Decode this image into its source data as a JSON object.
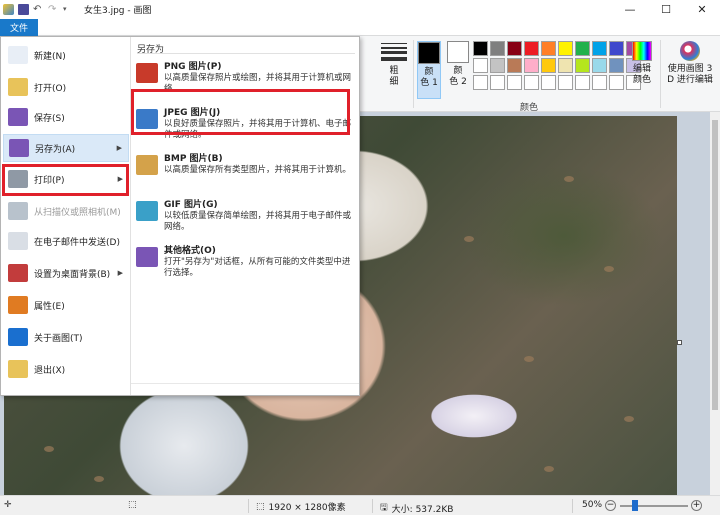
{
  "window": {
    "title": "女生3.jpg - 画图",
    "minimize_glyph": "—",
    "maximize_glyph": "☐",
    "close_glyph": "✕"
  },
  "ribbon": {
    "file_tab": "文件",
    "size_label": "粗\n细",
    "color1_label": "颜\n色 1",
    "color2_label": "颜\n色 2",
    "colors_group_label": "颜色",
    "edit_colors_label": "编辑\n颜色",
    "paint3d_label": "使用画图 3\nD 进行编辑",
    "color1": "#000000",
    "color2": "#ffffff",
    "palette": [
      "#000000",
      "#7f7f7f",
      "#880015",
      "#ed1c24",
      "#ff7f27",
      "#fff200",
      "#22b14c",
      "#00a2e8",
      "#3f48cc",
      "#a349a4",
      "#ffffff",
      "#c3c3c3",
      "#b97a57",
      "#ffaec9",
      "#ffc90e",
      "#efe4b0",
      "#b5e61d",
      "#99d9ea",
      "#7092be",
      "#c8bfe7",
      "#ffffff",
      "#ffffff",
      "#ffffff",
      "#ffffff",
      "#ffffff",
      "#ffffff",
      "#ffffff",
      "#ffffff",
      "#ffffff",
      "#ffffff"
    ]
  },
  "file_menu": {
    "items": [
      {
        "label": "新建(N)",
        "icon": "new-file-icon",
        "color": "#e8eef6",
        "has_arrow": false,
        "disabled": false
      },
      {
        "label": "打开(O)",
        "icon": "open-folder-icon",
        "color": "#e8c35a",
        "has_arrow": false,
        "disabled": false
      },
      {
        "label": "保存(S)",
        "icon": "save-disk-icon",
        "color": "#7a55b5",
        "has_arrow": false,
        "disabled": false
      },
      {
        "label": "另存为(A)",
        "icon": "save-as-icon",
        "color": "#7a55b5",
        "has_arrow": true,
        "disabled": false
      },
      {
        "label": "打印(P)",
        "icon": "printer-icon",
        "color": "#8f99a5",
        "has_arrow": true,
        "disabled": false
      },
      {
        "label": "从扫描仪或照相机(M)",
        "icon": "scanner-icon",
        "color": "#b8c2cc",
        "has_arrow": false,
        "disabled": true
      },
      {
        "label": "在电子邮件中发送(D)",
        "icon": "email-icon",
        "color": "#d9dee5",
        "has_arrow": false,
        "disabled": false
      },
      {
        "label": "设置为桌面背景(B)",
        "icon": "desktop-background-icon",
        "color": "#c23c3c",
        "has_arrow": true,
        "disabled": false
      },
      {
        "label": "属性(E)",
        "icon": "checkmark-icon",
        "color": "#e07b22",
        "has_arrow": false,
        "disabled": false
      },
      {
        "label": "关于画图(T)",
        "icon": "info-icon",
        "color": "#1a6fcf",
        "has_arrow": false,
        "disabled": false
      },
      {
        "label": "退出(X)",
        "icon": "exit-icon",
        "color": "#e8c35a",
        "has_arrow": false,
        "disabled": false
      }
    ],
    "save_as_heading": "另存为",
    "save_as_options": [
      {
        "title": "PNG 图片(P)",
        "desc": "以高质量保存照片或绘图，并将其用于计算机或网络。",
        "icon": "png-image-icon",
        "color": "#c83a2a"
      },
      {
        "title": "JPEG 图片(J)",
        "desc": "以良好质量保存照片，并将其用于计算机、电子邮件或网络。",
        "icon": "jpeg-image-icon",
        "color": "#3a7ac8"
      },
      {
        "title": "BMP 图片(B)",
        "desc": "以高质量保存所有类型图片，并将其用于计算机。",
        "icon": "bmp-image-icon",
        "color": "#d4a24a"
      },
      {
        "title": "GIF 图片(G)",
        "desc": "以较低质量保存简单绘图，并将其用于电子邮件或网络。",
        "icon": "gif-image-icon",
        "color": "#3aa0c8"
      },
      {
        "title": "其他格式(O)",
        "desc": "打开\"另存为\"对话框，从所有可能的文件类型中进行选择。",
        "icon": "other-formats-icon",
        "color": "#7a55b5"
      }
    ]
  },
  "statusbar": {
    "dimensions": "1920 × 1280像素",
    "size": "大小: 537.2KB",
    "zoom": "50%"
  }
}
